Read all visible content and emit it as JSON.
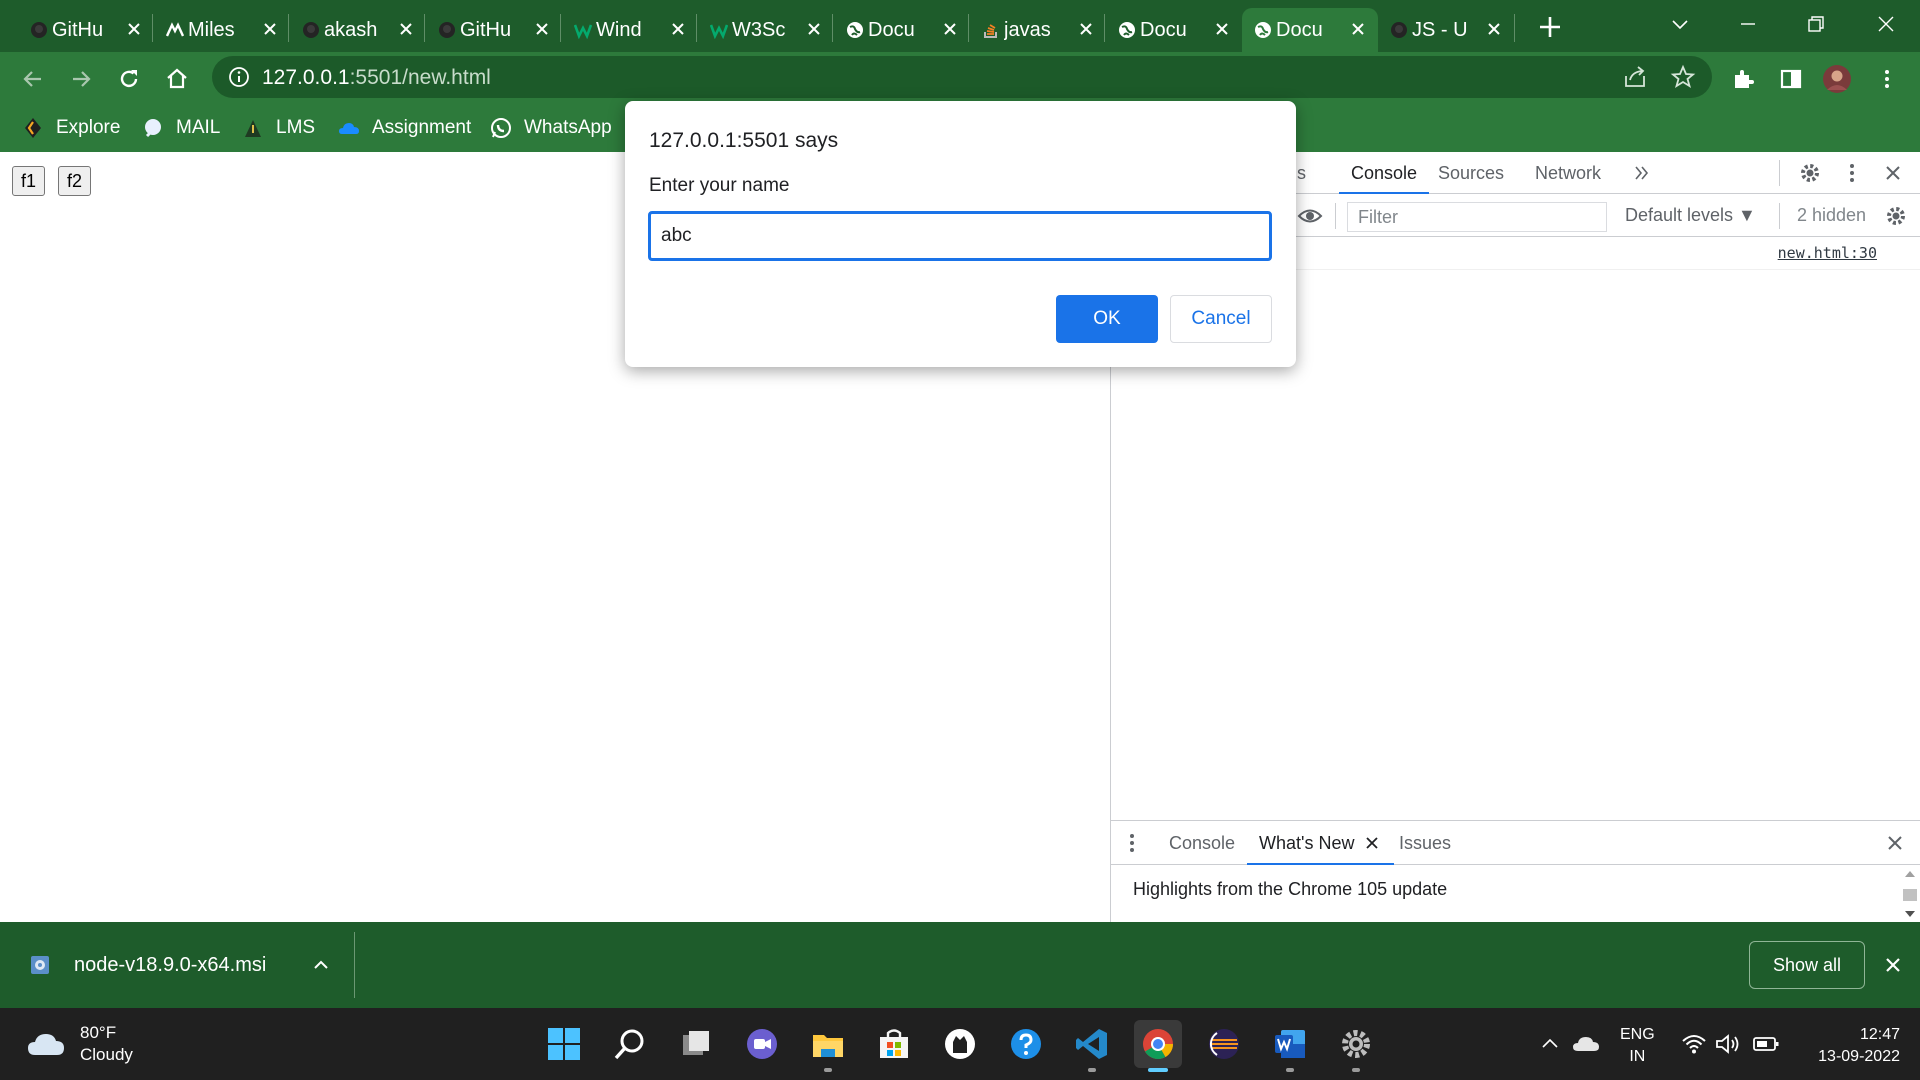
{
  "browser": {
    "tabs": [
      {
        "title": "GitHu",
        "icon": "github-icon",
        "active": false
      },
      {
        "title": "Miles",
        "icon": "miles-icon",
        "active": false
      },
      {
        "title": "akash",
        "icon": "github-icon",
        "active": false
      },
      {
        "title": "GitHu",
        "icon": "github-icon",
        "active": false
      },
      {
        "title": "Wind",
        "icon": "w3schools-icon",
        "active": false
      },
      {
        "title": "W3Sc",
        "icon": "w3schools-icon",
        "active": false
      },
      {
        "title": "Docu",
        "icon": "globe-icon",
        "active": false
      },
      {
        "title": "javas",
        "icon": "stackoverflow-icon",
        "active": false
      },
      {
        "title": "Docu",
        "icon": "globe-icon",
        "active": false
      },
      {
        "title": "Docu",
        "icon": "globe-icon",
        "active": true
      },
      {
        "title": "JS - U",
        "icon": "github-icon",
        "active": false
      }
    ],
    "url_host": "127.0.0.1",
    "url_rest": ":5501/new.html",
    "bookmarks": [
      {
        "label": "Explore",
        "icon": "explore-icon"
      },
      {
        "label": "MAIL",
        "icon": "mail-icon"
      },
      {
        "label": "LMS",
        "icon": "lms-icon"
      },
      {
        "label": "Assignment",
        "icon": "onedrive-icon"
      },
      {
        "label": "WhatsApp",
        "icon": "whatsapp-icon"
      }
    ],
    "theme_color": "#2d7a3b",
    "tabstrip_color": "#1e5c2b"
  },
  "page": {
    "buttons": [
      "f1",
      "f2"
    ]
  },
  "dialog": {
    "title": "127.0.0.1:5501 says",
    "message": "Enter your name",
    "input_value": "abc",
    "ok_label": "OK",
    "cancel_label": "Cancel",
    "accent_color": "#1a73e8"
  },
  "devtools": {
    "tabs": [
      {
        "label": "s",
        "selected": false
      },
      {
        "label": "Console",
        "selected": true
      },
      {
        "label": "Sources",
        "selected": false
      },
      {
        "label": "Network",
        "selected": false
      }
    ],
    "filter_placeholder": "Filter",
    "levels_label": "Default levels ▼",
    "hidden_count": "2 hidden",
    "log_link": "new.html:30",
    "drawer": {
      "tabs": [
        {
          "label": "Console",
          "selected": false
        },
        {
          "label": "What's New",
          "selected": true
        },
        {
          "label": "Issues",
          "selected": false
        }
      ],
      "body": "Highlights from the Chrome 105 update"
    }
  },
  "downloads": {
    "file": "node-v18.9.0-x64.msi",
    "show_all_label": "Show all"
  },
  "taskbar": {
    "weather_temp": "80°F",
    "weather_desc": "Cloudy",
    "apps": [
      "start-icon",
      "search-icon",
      "task-view-icon",
      "teams-chat-icon",
      "file-explorer-icon",
      "microsoft-store-icon",
      "github-desktop-icon",
      "help-icon",
      "vscode-icon",
      "chrome-icon",
      "eclipse-icon",
      "word-icon",
      "settings-icon"
    ],
    "lang_top": "ENG",
    "lang_bottom": "IN",
    "time": "12:47",
    "date": "13-09-2022"
  }
}
